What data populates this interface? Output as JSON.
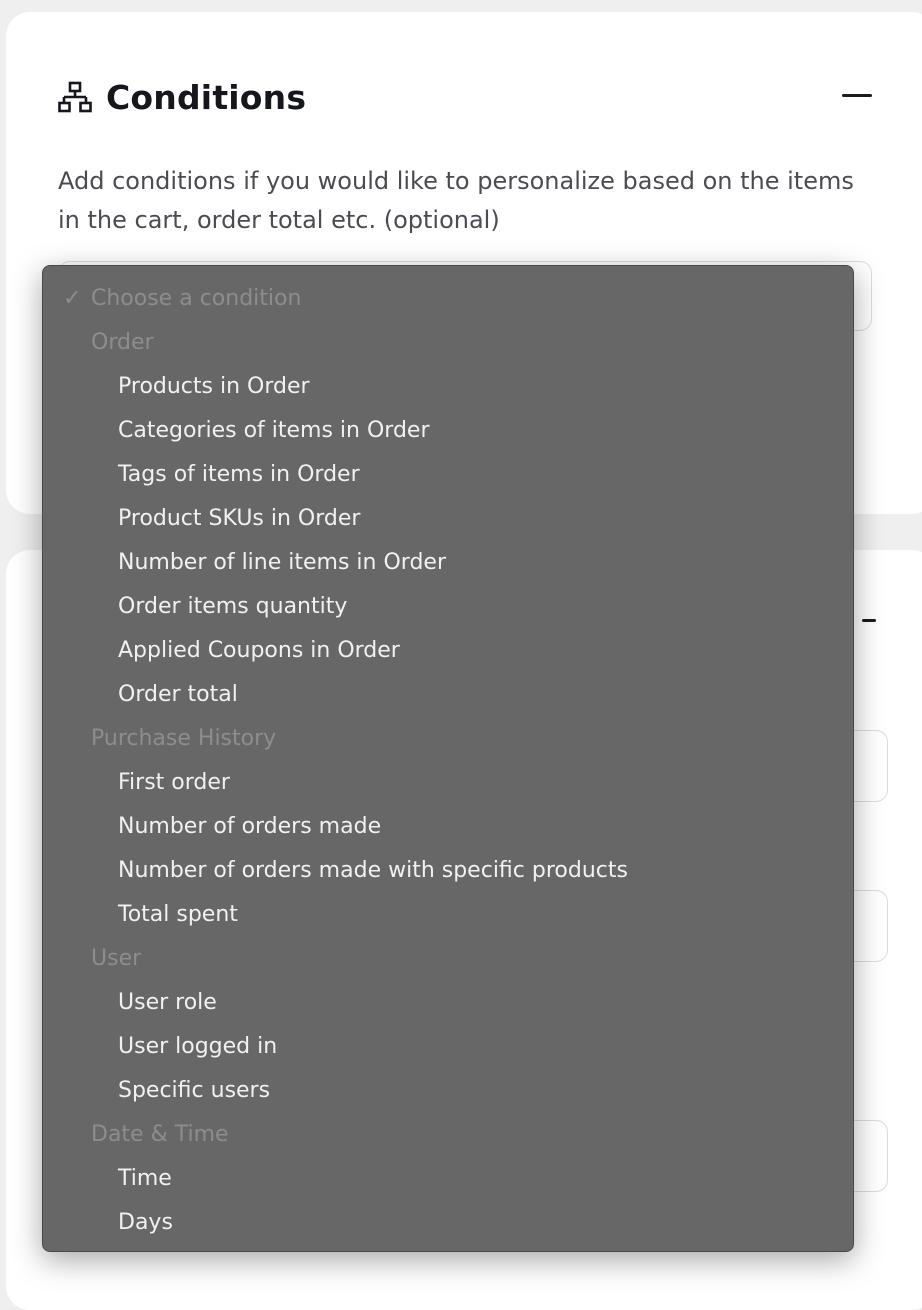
{
  "card": {
    "title": "Conditions",
    "description": "Add conditions if you would like to personalize based on the items in the cart, order total etc. (optional)"
  },
  "dropdown": {
    "placeholder": "Choose a condition",
    "groups": [
      {
        "label": "Order",
        "options": [
          "Products in Order",
          "Categories of items in Order",
          "Tags of items in Order",
          "Product SKUs in Order",
          "Number of line items in Order",
          "Order items quantity",
          "Applied Coupons in Order",
          "Order total"
        ]
      },
      {
        "label": "Purchase History",
        "options": [
          "First order",
          "Number of orders made",
          "Number of orders made with specific products",
          "Total spent"
        ]
      },
      {
        "label": "User",
        "options": [
          "User role",
          "User logged in",
          "Specific users"
        ]
      },
      {
        "label": "Date & Time",
        "options": [
          "Time",
          "Days"
        ]
      }
    ]
  },
  "icons": {
    "header": "sitemap-icon",
    "check": "checkmark-icon",
    "collapse": "minus-icon"
  }
}
